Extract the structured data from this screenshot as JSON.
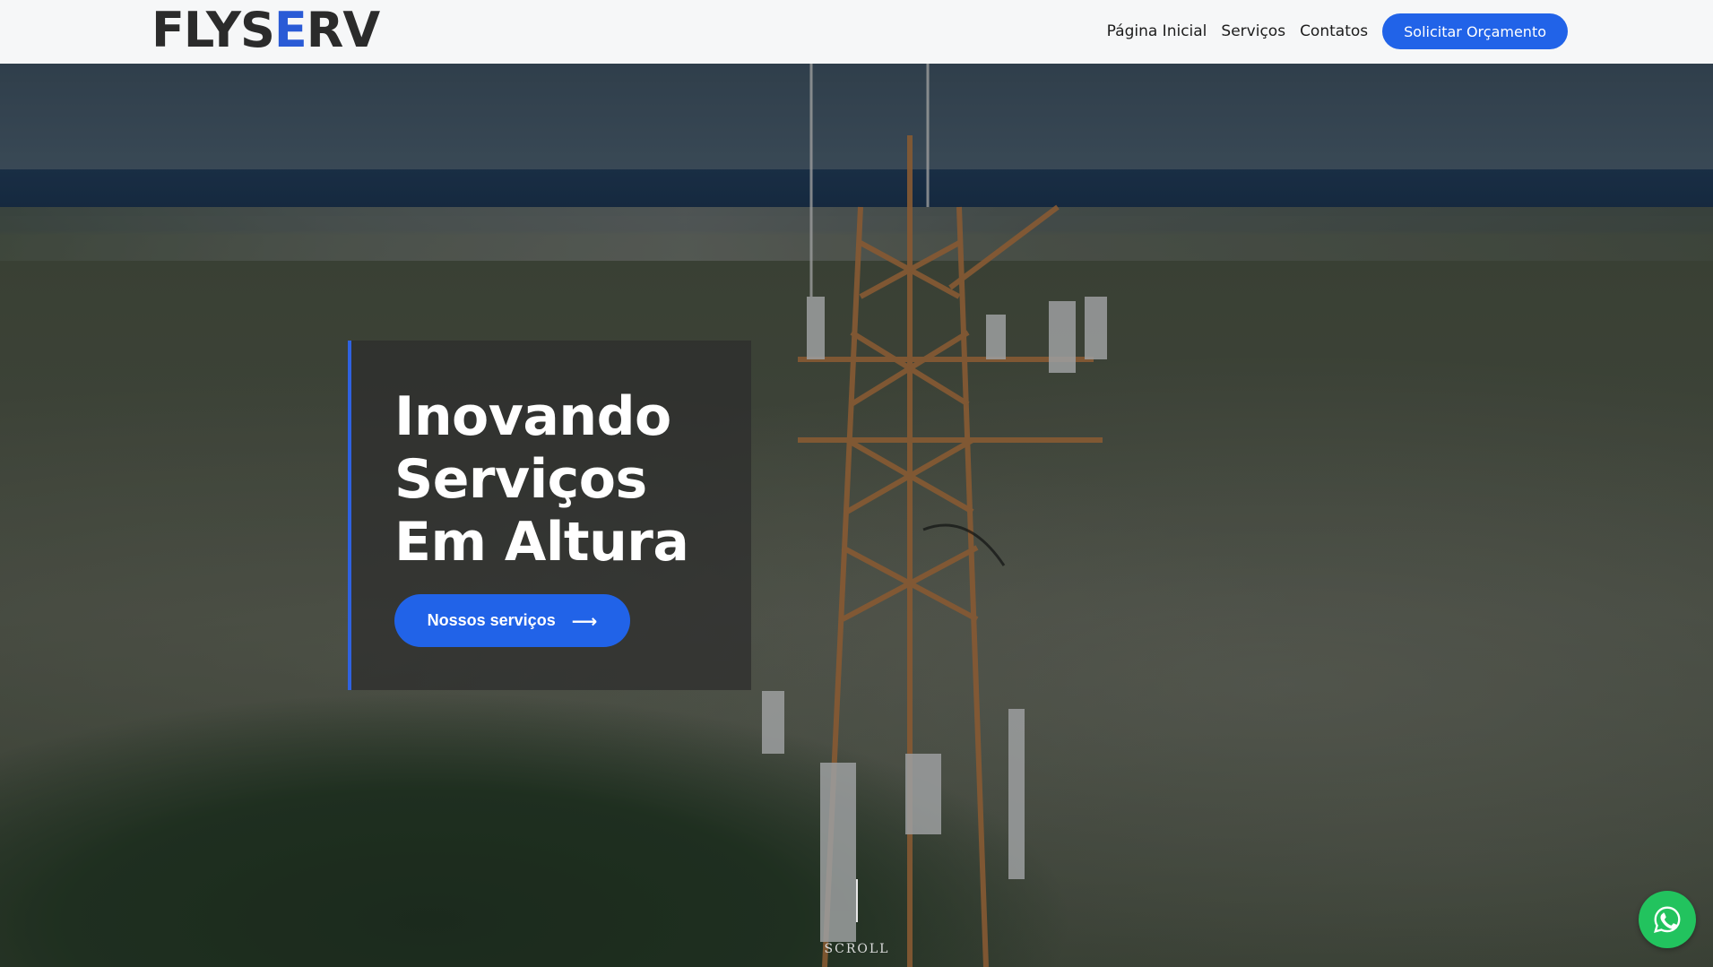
{
  "header": {
    "logo_text": "FLYSERV",
    "logo_prefix": "FLYS",
    "logo_accent": "E",
    "logo_suffix": "RV",
    "nav": {
      "home": "Página Inicial",
      "services": "Serviços",
      "contacts": "Contatos"
    },
    "cta_label": "Solicitar Orçamento"
  },
  "hero": {
    "title_line1": "Inovando",
    "title_line2": "Serviços",
    "title_line3": "Em Altura",
    "button_label": "Nossos serviços",
    "button_icon": "arrow-right-icon",
    "scroll_label": "SCROLL"
  },
  "floating": {
    "whatsapp_icon": "whatsapp-icon"
  },
  "colors": {
    "accent": "#2163e8",
    "whatsapp": "#22c35e",
    "header_bg": "#f6f7f8"
  }
}
